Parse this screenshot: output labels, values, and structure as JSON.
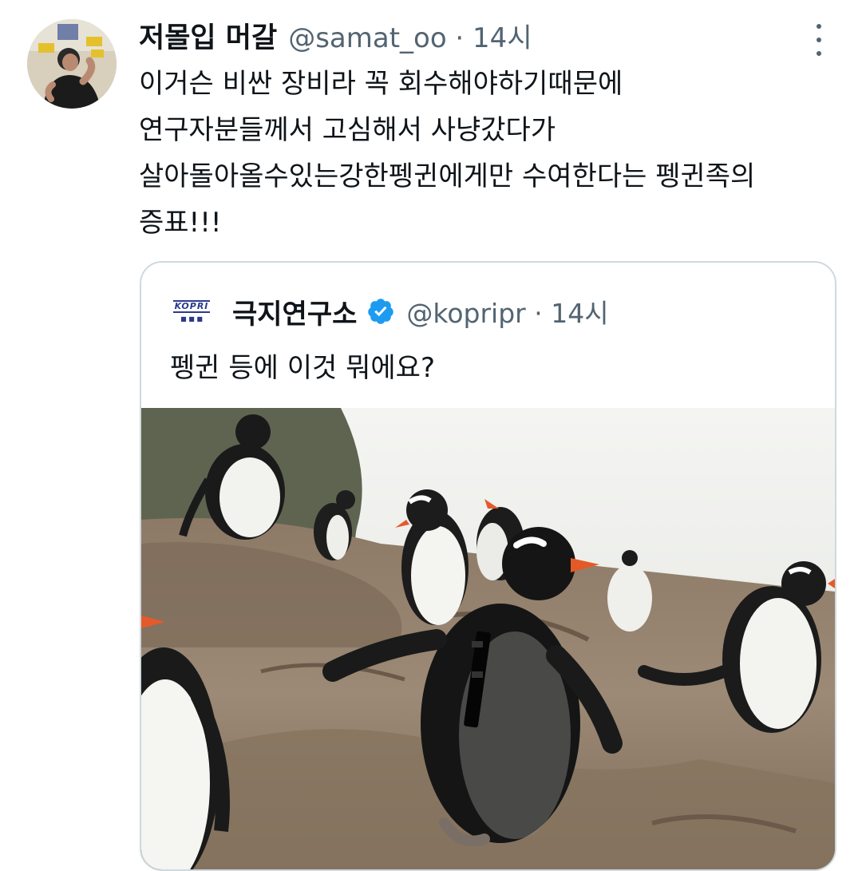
{
  "tweet": {
    "author_name": "저몰입 머갈",
    "meta": "@samat_oo · 14시",
    "text": "이거슨 비싼 장비라 꼭 회수해야하기때문에\n연구자분들께서 고심해서 사냥갔다가\n살아돌아올수있는강한펭귄에게만 수여한다는 펭귄족의\n증표!!!",
    "more_icon": "more-vertical-icon"
  },
  "quote": {
    "logo_text": "KOPRI",
    "author_name": "극지연구소",
    "meta": "@kopripr · 14시",
    "text": "펭귄 등에 이것 뭐에요?",
    "verified_icon": "verified-badge-icon",
    "verified_color": "#1d9bf0",
    "photo": "gentoo-penguins-on-rocks-with-tracker-photo"
  }
}
